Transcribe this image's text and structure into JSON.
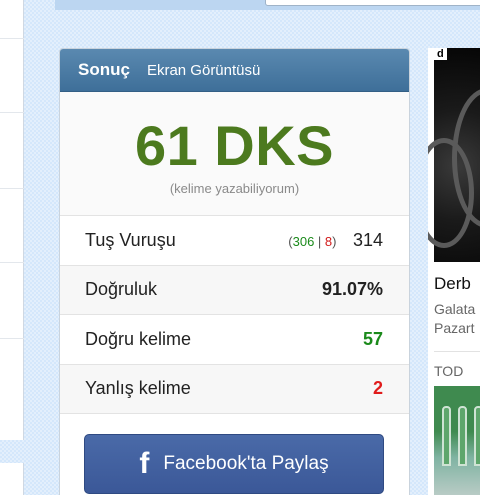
{
  "result": {
    "title": "Sonuç",
    "tab": "Ekran Görüntüsü",
    "wpm": "61 DKS",
    "wpm_note": "(kelime yazabiliyorum)",
    "stats": {
      "keystrokes": {
        "label": "Tuş Vuruşu",
        "open": "(",
        "correct": "306",
        "sep": " | ",
        "wrong": "8",
        "close": ")",
        "value": "314"
      },
      "accuracy": {
        "label": "Doğruluk",
        "value": "91.07%"
      },
      "correct_words": {
        "label": "Doğru kelime",
        "value": "57"
      },
      "wrong_words": {
        "label": "Yanlış kelime",
        "value": "2"
      }
    },
    "share": {
      "icon": "f",
      "label": "Facebook'ta Paylaş"
    }
  },
  "side": {
    "badge": "d",
    "title": "Derb",
    "line1": "Galata",
    "line2": "Pazart",
    "tag": "TOD"
  },
  "colors": {
    "header": "#4a7ba3",
    "wpm": "#4c7a1e",
    "correct": "#1b8a1b",
    "wrong": "#e01b1b",
    "facebook": "#3b5898"
  }
}
